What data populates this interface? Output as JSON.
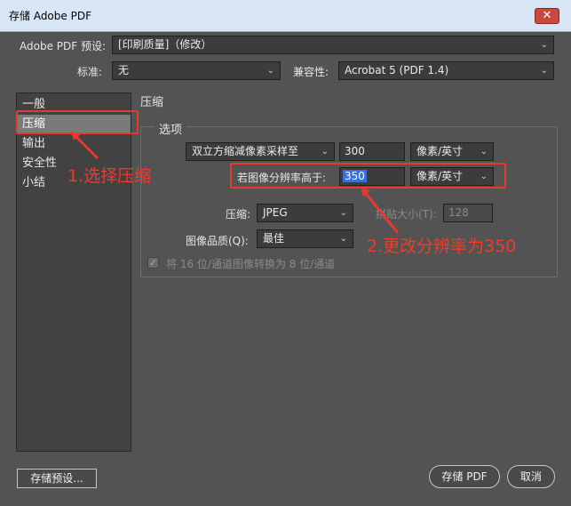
{
  "window": {
    "title": "存储 Adobe PDF",
    "close_glyph": "✕"
  },
  "preset": {
    "label": "Adobe PDF 预设:",
    "value": "[印刷质量]（修改）"
  },
  "standard": {
    "label": "标准:",
    "value": "无"
  },
  "compat": {
    "label": "兼容性:",
    "value": "Acrobat 5 (PDF 1.4)"
  },
  "sidebar": {
    "items": [
      {
        "label": "一般"
      },
      {
        "label": "压缩"
      },
      {
        "label": "输出"
      },
      {
        "label": "安全性"
      },
      {
        "label": "小结"
      }
    ],
    "active_index": 1
  },
  "section": {
    "title": "压缩",
    "group_label": "选项"
  },
  "options": {
    "resample_method": "双立方缩减像素采样至",
    "resample_value": "300",
    "resample_unit": "像素/英寸",
    "threshold_label": "若图像分辨率高于:",
    "threshold_value": "350",
    "threshold_unit": "像素/英寸",
    "compression_label": "压缩:",
    "compression_value": "JPEG",
    "tile_label": "拼贴大小(T):",
    "tile_value": "128",
    "quality_label": "图像品质(Q):",
    "quality_value": "最佳",
    "convert16_label": "将 16 位/通道图像转换为 8 位/通道",
    "convert16_checked": true
  },
  "buttons": {
    "save_preset": "存储预设...",
    "save_pdf": "存储 PDF",
    "cancel": "取消"
  },
  "annotations": {
    "step1": "1.选择压缩",
    "step2": "2.更改分辨率为350"
  },
  "colors": {
    "dialog_bg": "#535353",
    "annotation_red": "#e53a2f",
    "titlebar_bg": "#d8e5f5"
  }
}
